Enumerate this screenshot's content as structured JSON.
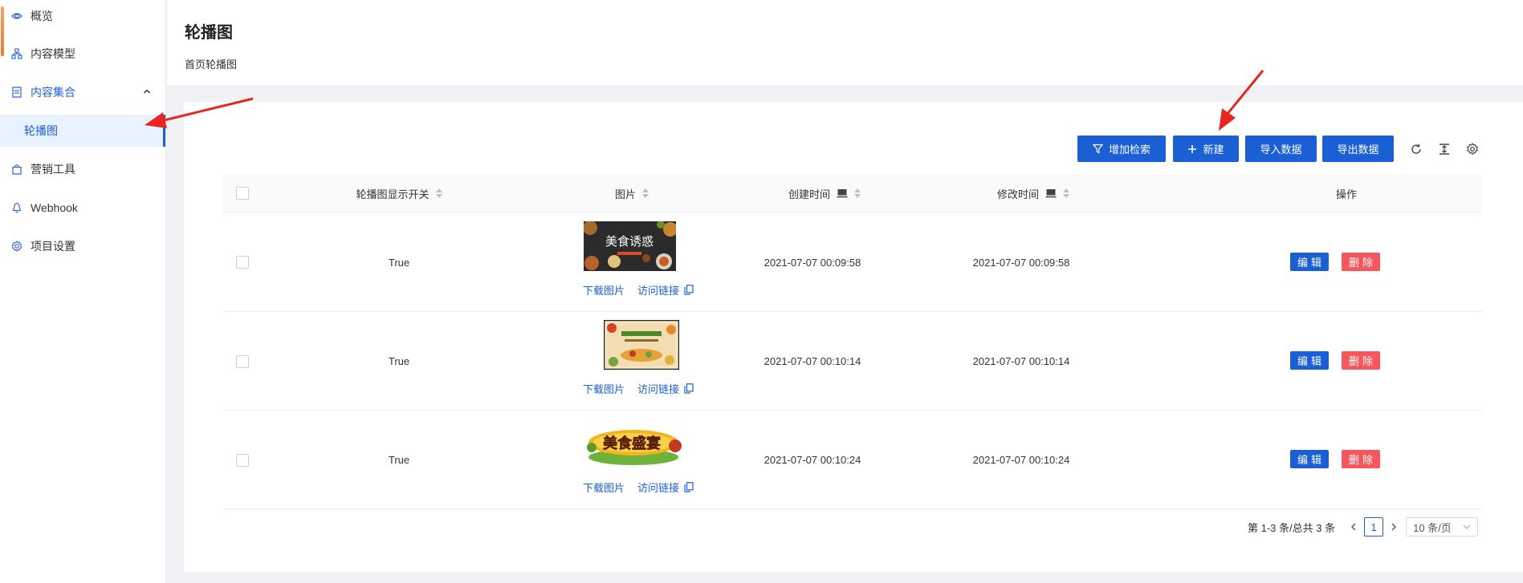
{
  "sidebar": {
    "items": [
      {
        "label": "概览",
        "icon": "eye-icon"
      },
      {
        "label": "内容模型",
        "icon": "model-icon"
      },
      {
        "label": "内容集合",
        "icon": "collection-icon"
      },
      {
        "label": "轮播图"
      },
      {
        "label": "营销工具",
        "icon": "bag-icon"
      },
      {
        "label": "Webhook",
        "icon": "webhook-icon"
      },
      {
        "label": "项目设置",
        "icon": "gear-icon"
      }
    ]
  },
  "header": {
    "title": "轮播图",
    "subtitle": "首页轮播图"
  },
  "toolbar": {
    "filter_label": "增加检索",
    "new_label": "新建",
    "import_label": "导入数据",
    "export_label": "导出数据"
  },
  "table": {
    "columns": [
      "轮播图显示开关",
      "图片",
      "创建时间",
      "修改时间",
      "操作"
    ],
    "rows": [
      {
        "switch": "True",
        "image_text": "美食诱惑",
        "created": "2021-07-07 00:09:58",
        "modified": "2021-07-07 00:09:58"
      },
      {
        "switch": "True",
        "image_text": "",
        "created": "2021-07-07 00:10:14",
        "modified": "2021-07-07 00:10:14"
      },
      {
        "switch": "True",
        "image_text": "美食盛宴",
        "created": "2021-07-07 00:10:24",
        "modified": "2021-07-07 00:10:24"
      }
    ],
    "download_label": "下载图片",
    "visit_label": "访问链接",
    "edit_label": "编辑",
    "delete_label": "删除"
  },
  "pagination": {
    "summary": "第 1-3 条/总共 3 条",
    "current_page": "1",
    "page_size": "10 条/页"
  },
  "colors": {
    "primary": "#1a5fd4",
    "danger": "#f5575c",
    "annotation": "#e8251f"
  }
}
